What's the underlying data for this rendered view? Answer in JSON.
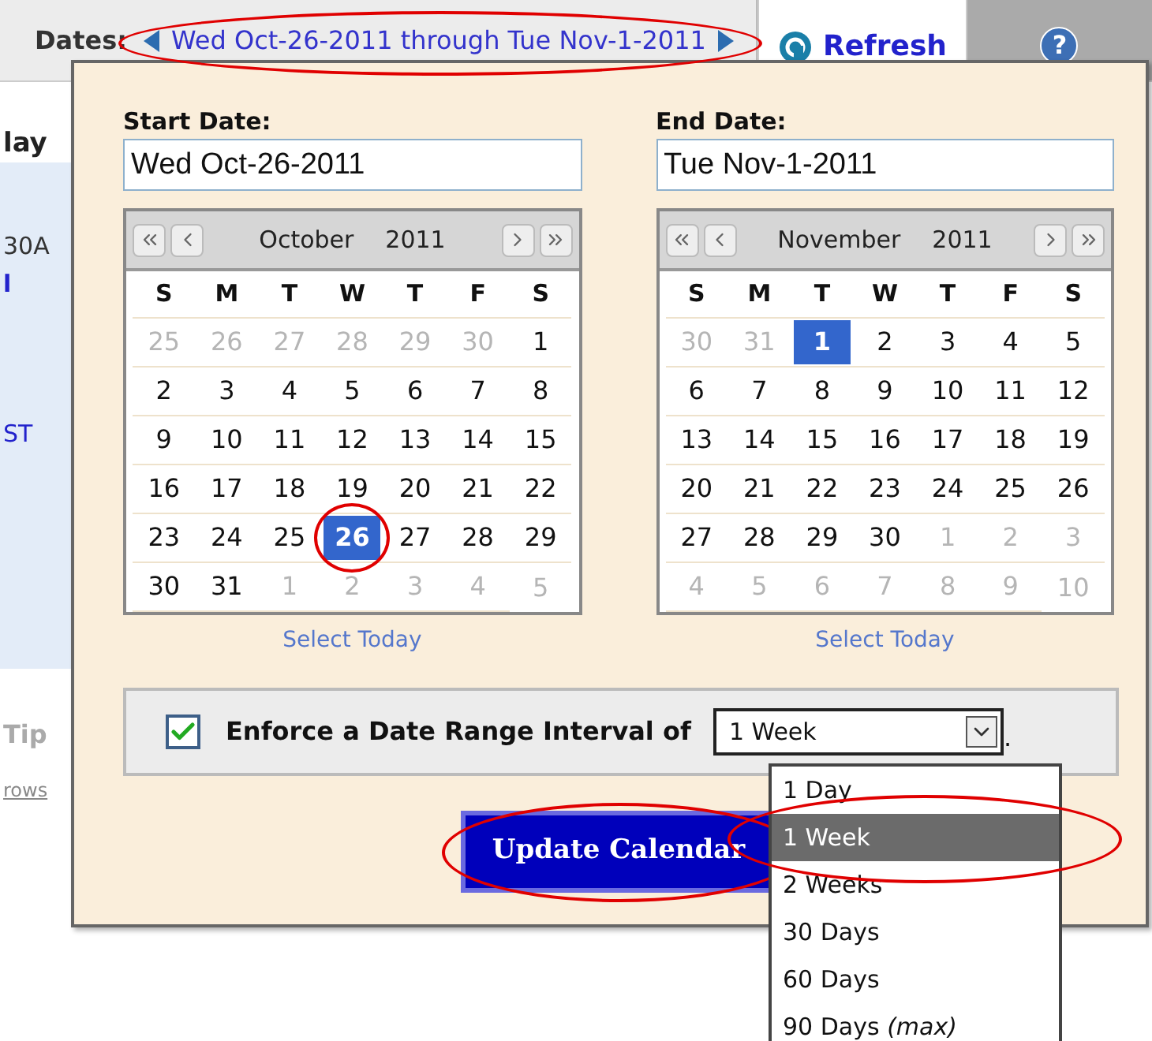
{
  "toolbar": {
    "label": "Dates:",
    "range_link": "Wed Oct-26-2011 through Tue Nov-1-2011",
    "range_circled": true,
    "refresh": "Refresh",
    "help": "?"
  },
  "background": {
    "fragments": [
      {
        "kind": "heading",
        "text": "lay"
      },
      {
        "kind": "plain",
        "text": "30A"
      },
      {
        "kind": "bold_link",
        "text": "l"
      },
      {
        "kind": "link",
        "text": "ST"
      },
      {
        "kind": "muted",
        "text": "Tip"
      },
      {
        "kind": "underlined",
        "text": "rows"
      }
    ]
  },
  "popup": {
    "calendars": [
      {
        "label": "Start Date:",
        "value": "Wed Oct-26-2011",
        "month": "October",
        "year": "2011",
        "weekdays": [
          "S",
          "M",
          "T",
          "W",
          "T",
          "F",
          "S"
        ],
        "select_today": "Select Today",
        "weeks": [
          [
            {
              "day": "25",
              "other_month": true,
              "selected": false
            },
            {
              "day": "26",
              "other_month": true,
              "selected": false
            },
            {
              "day": "27",
              "other_month": true,
              "selected": false
            },
            {
              "day": "28",
              "other_month": true,
              "selected": false
            },
            {
              "day": "29",
              "other_month": true,
              "selected": false
            },
            {
              "day": "30",
              "other_month": true,
              "selected": false
            },
            {
              "day": "1",
              "other_month": false,
              "selected": false
            }
          ],
          [
            {
              "day": "2",
              "other_month": false,
              "selected": false
            },
            {
              "day": "3",
              "other_month": false,
              "selected": false
            },
            {
              "day": "4",
              "other_month": false,
              "selected": false
            },
            {
              "day": "5",
              "other_month": false,
              "selected": false
            },
            {
              "day": "6",
              "other_month": false,
              "selected": false
            },
            {
              "day": "7",
              "other_month": false,
              "selected": false
            },
            {
              "day": "8",
              "other_month": false,
              "selected": false
            }
          ],
          [
            {
              "day": "9",
              "other_month": false,
              "selected": false
            },
            {
              "day": "10",
              "other_month": false,
              "selected": false
            },
            {
              "day": "11",
              "other_month": false,
              "selected": false
            },
            {
              "day": "12",
              "other_month": false,
              "selected": false
            },
            {
              "day": "13",
              "other_month": false,
              "selected": false
            },
            {
              "day": "14",
              "other_month": false,
              "selected": false
            },
            {
              "day": "15",
              "other_month": false,
              "selected": false
            }
          ],
          [
            {
              "day": "16",
              "other_month": false,
              "selected": false
            },
            {
              "day": "17",
              "other_month": false,
              "selected": false
            },
            {
              "day": "18",
              "other_month": false,
              "selected": false
            },
            {
              "day": "19",
              "other_month": false,
              "selected": false
            },
            {
              "day": "20",
              "other_month": false,
              "selected": false
            },
            {
              "day": "21",
              "other_month": false,
              "selected": false
            },
            {
              "day": "22",
              "other_month": false,
              "selected": false
            }
          ],
          [
            {
              "day": "23",
              "other_month": false,
              "selected": false
            },
            {
              "day": "24",
              "other_month": false,
              "selected": false
            },
            {
              "day": "25",
              "other_month": false,
              "selected": false
            },
            {
              "day": "26",
              "other_month": false,
              "selected": true,
              "circled": true
            },
            {
              "day": "27",
              "other_month": false,
              "selected": false
            },
            {
              "day": "28",
              "other_month": false,
              "selected": false
            },
            {
              "day": "29",
              "other_month": false,
              "selected": false
            }
          ],
          [
            {
              "day": "30",
              "other_month": false,
              "selected": false
            },
            {
              "day": "31",
              "other_month": false,
              "selected": false
            },
            {
              "day": "1",
              "other_month": true,
              "selected": false
            },
            {
              "day": "2",
              "other_month": true,
              "selected": false
            },
            {
              "day": "3",
              "other_month": true,
              "selected": false
            },
            {
              "day": "4",
              "other_month": true,
              "selected": false
            },
            {
              "day": "5",
              "other_month": true,
              "selected": false
            }
          ]
        ]
      },
      {
        "label": "End Date:",
        "value": "Tue Nov-1-2011",
        "month": "November",
        "year": "2011",
        "weekdays": [
          "S",
          "M",
          "T",
          "W",
          "T",
          "F",
          "S"
        ],
        "select_today": "Select Today",
        "weeks": [
          [
            {
              "day": "30",
              "other_month": true,
              "selected": false
            },
            {
              "day": "31",
              "other_month": true,
              "selected": false
            },
            {
              "day": "1",
              "other_month": false,
              "selected": true
            },
            {
              "day": "2",
              "other_month": false,
              "selected": false
            },
            {
              "day": "3",
              "other_month": false,
              "selected": false
            },
            {
              "day": "4",
              "other_month": false,
              "selected": false
            },
            {
              "day": "5",
              "other_month": false,
              "selected": false
            }
          ],
          [
            {
              "day": "6",
              "other_month": false,
              "selected": false
            },
            {
              "day": "7",
              "other_month": false,
              "selected": false
            },
            {
              "day": "8",
              "other_month": false,
              "selected": false
            },
            {
              "day": "9",
              "other_month": false,
              "selected": false
            },
            {
              "day": "10",
              "other_month": false,
              "selected": false
            },
            {
              "day": "11",
              "other_month": false,
              "selected": false
            },
            {
              "day": "12",
              "other_month": false,
              "selected": false
            }
          ],
          [
            {
              "day": "13",
              "other_month": false,
              "selected": false
            },
            {
              "day": "14",
              "other_month": false,
              "selected": false
            },
            {
              "day": "15",
              "other_month": false,
              "selected": false
            },
            {
              "day": "16",
              "other_month": false,
              "selected": false
            },
            {
              "day": "17",
              "other_month": false,
              "selected": false
            },
            {
              "day": "18",
              "other_month": false,
              "selected": false
            },
            {
              "day": "19",
              "other_month": false,
              "selected": false
            }
          ],
          [
            {
              "day": "20",
              "other_month": false,
              "selected": false
            },
            {
              "day": "21",
              "other_month": false,
              "selected": false
            },
            {
              "day": "22",
              "other_month": false,
              "selected": false
            },
            {
              "day": "23",
              "other_month": false,
              "selected": false
            },
            {
              "day": "24",
              "other_month": false,
              "selected": false
            },
            {
              "day": "25",
              "other_month": false,
              "selected": false
            },
            {
              "day": "26",
              "other_month": false,
              "selected": false
            }
          ],
          [
            {
              "day": "27",
              "other_month": false,
              "selected": false
            },
            {
              "day": "28",
              "other_month": false,
              "selected": false
            },
            {
              "day": "29",
              "other_month": false,
              "selected": false
            },
            {
              "day": "30",
              "other_month": false,
              "selected": false
            },
            {
              "day": "1",
              "other_month": true,
              "selected": false
            },
            {
              "day": "2",
              "other_month": true,
              "selected": false
            },
            {
              "day": "3",
              "other_month": true,
              "selected": false
            }
          ],
          [
            {
              "day": "4",
              "other_month": true,
              "selected": false
            },
            {
              "day": "5",
              "other_month": true,
              "selected": false
            },
            {
              "day": "6",
              "other_month": true,
              "selected": false
            },
            {
              "day": "7",
              "other_month": true,
              "selected": false
            },
            {
              "day": "8",
              "other_month": true,
              "selected": false
            },
            {
              "day": "9",
              "other_month": true,
              "selected": false
            },
            {
              "day": "10",
              "other_month": true,
              "selected": false
            }
          ]
        ]
      }
    ],
    "interval": {
      "checked": true,
      "label": "Enforce a Date Range Interval of",
      "value": "1 Week",
      "suffix": ".",
      "expanded": true,
      "options": [
        {
          "text": "1 Day",
          "selected": false,
          "circled": false
        },
        {
          "text": "1 Week",
          "selected": true,
          "circled": true
        },
        {
          "text": "2 Weeks",
          "selected": false,
          "circled": false
        },
        {
          "text": "30 Days",
          "selected": false,
          "circled": false
        },
        {
          "text": "60 Days",
          "selected": false,
          "circled": false
        },
        {
          "text": "90 Days *(max)*",
          "selected": false,
          "circled": false
        }
      ]
    },
    "update_button": {
      "label": "Update Calendar",
      "circled": true
    }
  }
}
